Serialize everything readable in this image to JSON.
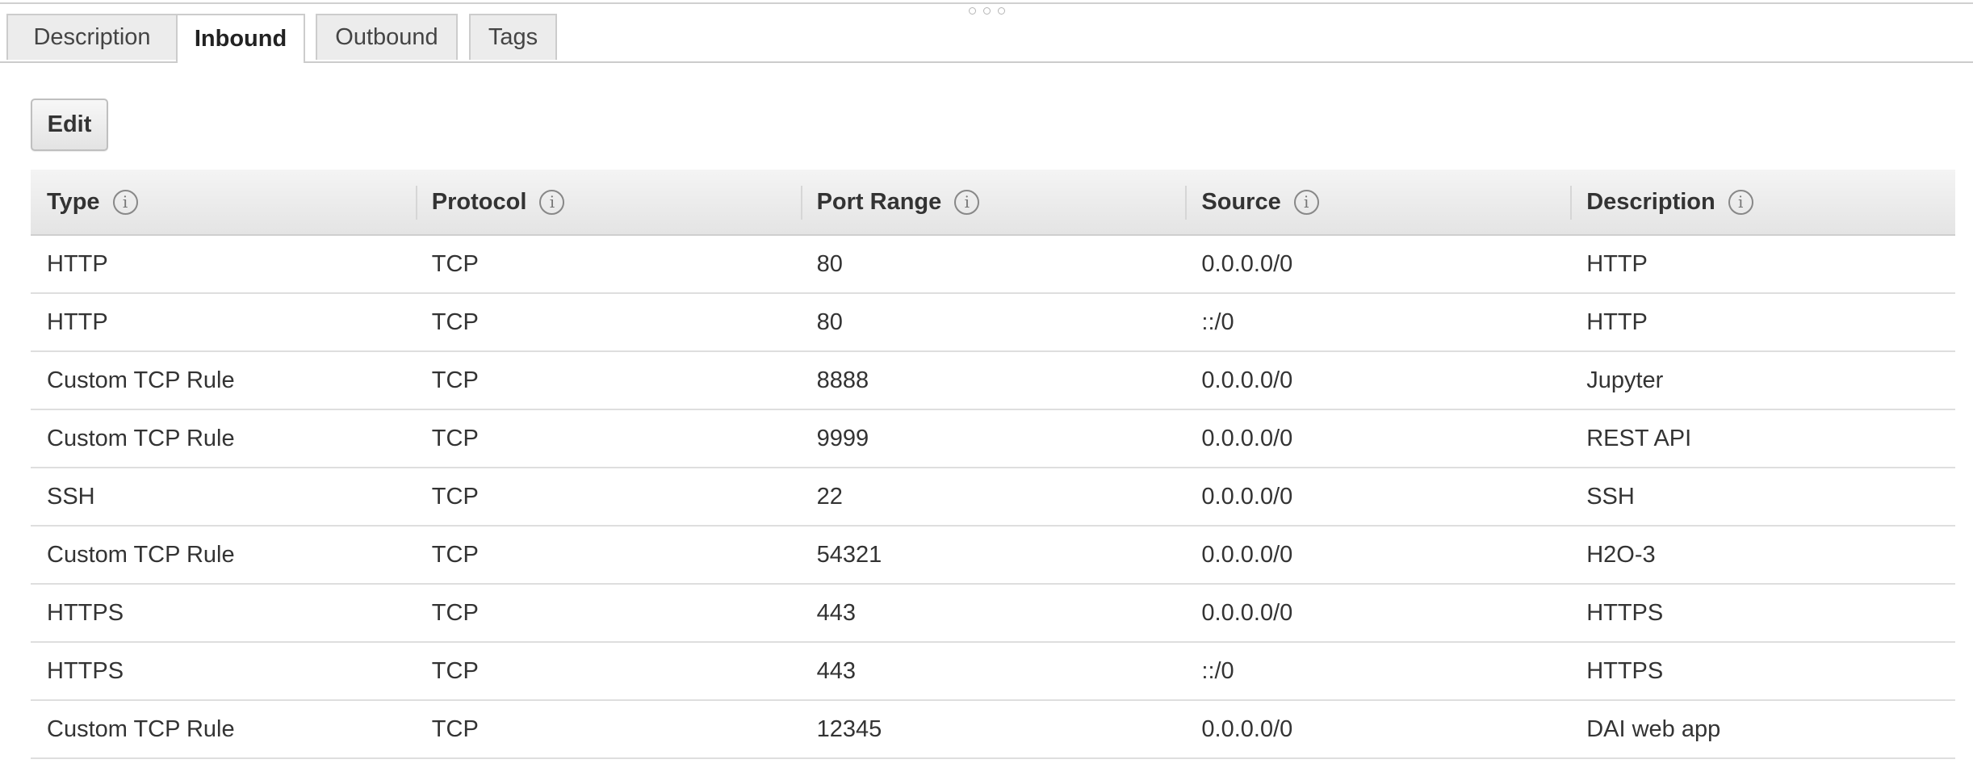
{
  "tabs": [
    {
      "label": "Description"
    },
    {
      "label": "Inbound"
    },
    {
      "label": "Outbound"
    },
    {
      "label": "Tags"
    }
  ],
  "active_tab": "Inbound",
  "edit_label": "Edit",
  "info_glyph": "i",
  "columns": [
    {
      "label": "Type"
    },
    {
      "label": "Protocol"
    },
    {
      "label": "Port Range"
    },
    {
      "label": "Source"
    },
    {
      "label": "Description"
    }
  ],
  "rows": [
    {
      "type": "HTTP",
      "protocol": "TCP",
      "port_range": "80",
      "source": "0.0.0.0/0",
      "description": "HTTP"
    },
    {
      "type": "HTTP",
      "protocol": "TCP",
      "port_range": "80",
      "source": "::/0",
      "description": "HTTP"
    },
    {
      "type": "Custom TCP Rule",
      "protocol": "TCP",
      "port_range": "8888",
      "source": "0.0.0.0/0",
      "description": "Jupyter"
    },
    {
      "type": "Custom TCP Rule",
      "protocol": "TCP",
      "port_range": "9999",
      "source": "0.0.0.0/0",
      "description": "REST API"
    },
    {
      "type": "SSH",
      "protocol": "TCP",
      "port_range": "22",
      "source": "0.0.0.0/0",
      "description": "SSH"
    },
    {
      "type": "Custom TCP Rule",
      "protocol": "TCP",
      "port_range": "54321",
      "source": "0.0.0.0/0",
      "description": "H2O-3"
    },
    {
      "type": "HTTPS",
      "protocol": "TCP",
      "port_range": "443",
      "source": "0.0.0.0/0",
      "description": "HTTPS"
    },
    {
      "type": "HTTPS",
      "protocol": "TCP",
      "port_range": "443",
      "source": "::/0",
      "description": "HTTPS"
    },
    {
      "type": "Custom TCP Rule",
      "protocol": "TCP",
      "port_range": "12345",
      "source": "0.0.0.0/0",
      "description": "DAI web app"
    }
  ]
}
